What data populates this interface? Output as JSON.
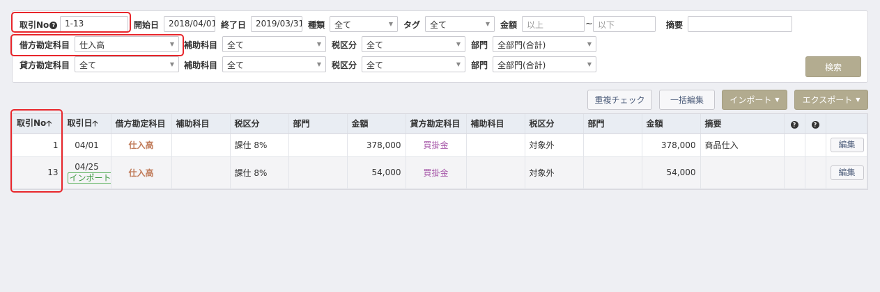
{
  "filters": {
    "row1": {
      "txn_no_label": "取引No",
      "txn_no_value": "1-13",
      "start_label": "開始日",
      "start_value": "2018/04/01",
      "end_label": "終了日",
      "end_value": "2019/03/31",
      "type_label": "種類",
      "type_value": "全て",
      "tag_label": "タグ",
      "tag_value": "全て",
      "amount_label": "金額",
      "amount_min_placeholder": "以上",
      "amount_tilde": "~",
      "amount_max_placeholder": "以下",
      "memo_label": "摘要",
      "memo_value": ""
    },
    "row2": {
      "debit_label": "借方勘定科目",
      "debit_value": "仕入高",
      "sub_label": "補助科目",
      "sub_value": "全て",
      "tax_label": "税区分",
      "tax_value": "全て",
      "dept_label": "部門",
      "dept_value": "全部門(合計)"
    },
    "row3": {
      "credit_label": "貸方勘定科目",
      "credit_value": "全て",
      "sub_label": "補助科目",
      "sub_value": "全て",
      "tax_label": "税区分",
      "tax_value": "全て",
      "dept_label": "部門",
      "dept_value": "全部門(合計)"
    },
    "search_button": "検索"
  },
  "toolbar": {
    "duplicate_check": "重複チェック",
    "bulk_edit": "一括編集",
    "import": "インポート",
    "export": "エクスポート"
  },
  "table": {
    "headers": {
      "txn_no": "取引No",
      "txn_date": "取引日",
      "debit_account": "借方勘定科目",
      "debit_sub": "補助科目",
      "debit_tax": "税区分",
      "debit_dept": "部門",
      "debit_amount": "金額",
      "credit_account": "貸方勘定科目",
      "credit_sub": "補助科目",
      "credit_tax": "税区分",
      "credit_dept": "部門",
      "credit_amount": "金額",
      "memo": "摘要"
    },
    "rows": [
      {
        "no": "1",
        "date": "04/01",
        "badge": "",
        "debit_account": "仕入高",
        "debit_sub": "",
        "debit_tax": "課仕 8%",
        "debit_dept": "",
        "debit_amount": "378,000",
        "credit_account": "買掛金",
        "credit_sub": "",
        "credit_tax": "対象外",
        "credit_dept": "",
        "credit_amount": "378,000",
        "memo": "商品仕入",
        "edit": "編集"
      },
      {
        "no": "13",
        "date": "04/25",
        "badge": "インポート",
        "debit_account": "仕入高",
        "debit_sub": "",
        "debit_tax": "課仕 8%",
        "debit_dept": "",
        "debit_amount": "54,000",
        "credit_account": "買掛金",
        "credit_sub": "",
        "credit_tax": "対象外",
        "credit_dept": "",
        "credit_amount": "54,000",
        "memo": "",
        "edit": "編集"
      }
    ]
  },
  "icons": {
    "help": "question-circle-icon",
    "sort": "arrow-up-icon",
    "dropdown": "caret-down-icon"
  },
  "colors": {
    "highlight": "#e8262b",
    "purchase_account": "#c07a58",
    "payable_account": "#a657a8",
    "import_badge": "#3f9a42",
    "primary_button": "#b3ac90"
  }
}
